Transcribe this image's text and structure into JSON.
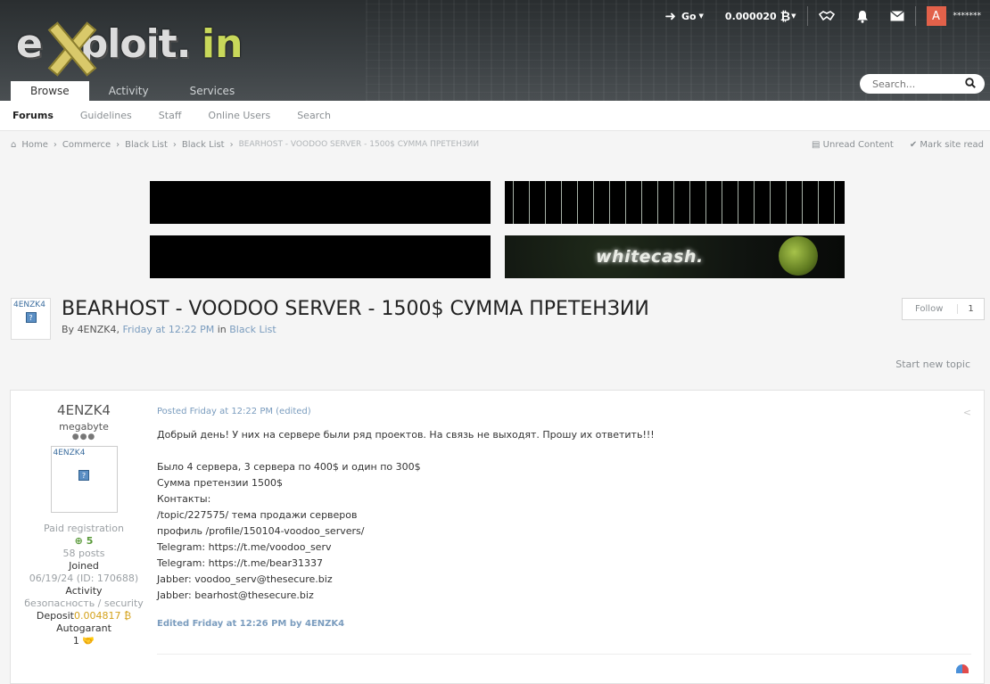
{
  "header": {
    "tabs": [
      {
        "label": "Browse"
      },
      {
        "label": "Activity"
      },
      {
        "label": "Services"
      }
    ],
    "search_placeholder": "Search...",
    "topbar": {
      "go_label": "Go",
      "balance": "0.000020",
      "currency_glyph": "₿",
      "avatar_letter": "A",
      "username_masked": "*******"
    }
  },
  "subnav": {
    "items": [
      "Forums",
      "Guidelines",
      "Staff",
      "Online Users",
      "Search"
    ]
  },
  "breadcrumb": {
    "items": [
      "Home",
      "Commerce",
      "Black List",
      "Black List"
    ],
    "current": "BEARHOST - VOODOO SERVER - 1500$ СУММА ПРЕТЕНЗИИ",
    "unread": "Unread Content",
    "mark_read": "Mark site read"
  },
  "banners": {
    "brand_text": "whitecash."
  },
  "topic": {
    "avatar_name": "4ENZK4",
    "title": "BEARHOST - VOODOO SERVER - 1500$ СУММА ПРЕТЕНЗИИ",
    "by_prefix": "By",
    "author": "4ENZK4,",
    "date": "Friday at 12:22 PM",
    "in_prefix": "in",
    "forum": "Black List",
    "follow_label": "Follow",
    "follow_count": "1",
    "start_new_topic": "Start new topic"
  },
  "post": {
    "author": {
      "name": "4ENZK4",
      "rank": "megabyte",
      "avatar_name": "4ENZK4",
      "group": "Paid registration",
      "reputation": "5",
      "posts": "58 posts",
      "joined_label": "Joined",
      "joined": "06/19/24 (ID: 170688)",
      "activity_label": "Activity",
      "activity": "безопасность / security",
      "deposit_label": "Deposit",
      "deposit": "0.004817",
      "autogarant_label": "Autogarant",
      "autogarant": "1"
    },
    "posted": "Posted Friday at 12:22 PM (edited)",
    "lines": [
      "Добрый день! У них на сервере были ряд проектов. На связь не выходят. Прошу их ответить!!!",
      "",
      "Было 4 сервера, 3 сервера по 400$ и один по 300$",
      "Сумма претензии 1500$",
      "Контакты:",
      "/topic/227575/ тема продажи серверов",
      "профиль /profile/150104-voodoo_servers/",
      "Telegram: https://t.me/voodoo_serv",
      "Telegram: https://t.me/bear31337",
      "Jabber: voodoo_serv@thesecure.biz",
      "Jabber: bearhost@thesecure.biz"
    ],
    "edited": "Edited Friday at 12:26 PM by 4ENZK4"
  }
}
